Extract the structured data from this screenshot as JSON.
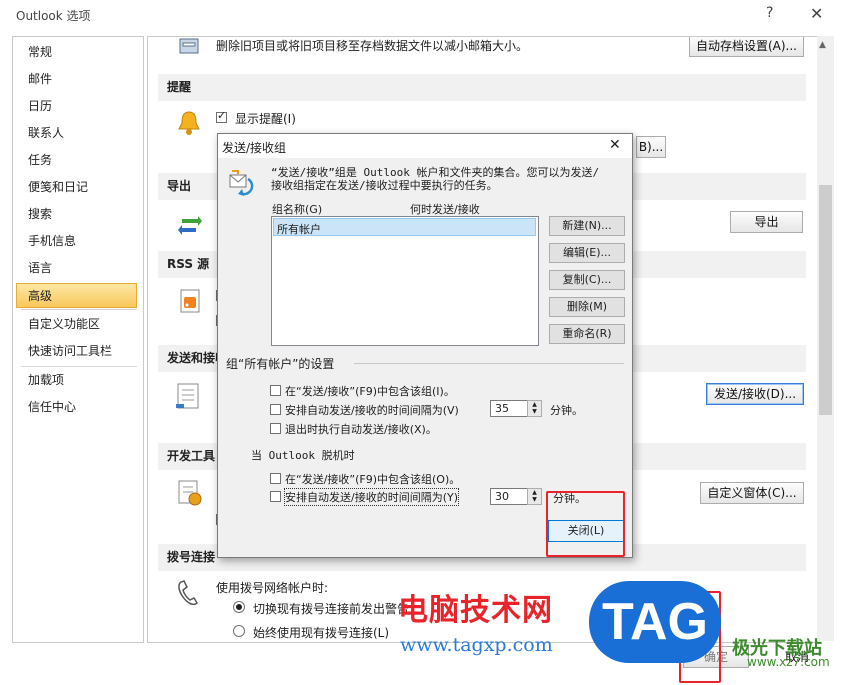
{
  "window": {
    "title": "Outlook 选项",
    "help_glyph": "?",
    "close_glyph": "✕"
  },
  "sidebar": {
    "items": [
      {
        "label": "常规"
      },
      {
        "label": "邮件"
      },
      {
        "label": "日历"
      },
      {
        "label": "联系人"
      },
      {
        "label": "任务"
      },
      {
        "label": "便笺和日记"
      },
      {
        "label": "搜索"
      },
      {
        "label": "手机信息"
      },
      {
        "label": "语言"
      },
      {
        "label": "高级"
      },
      {
        "label": "自定义功能区"
      },
      {
        "label": "快速访问工具栏"
      },
      {
        "label": "加载项"
      },
      {
        "label": "信任中心"
      }
    ],
    "active": "高级"
  },
  "content": {
    "autoarchive_text": "删除旧项目或将旧项目移至存档数据文件以减小邮箱大小。",
    "autoarchive_button": "自动存档设置(A)...",
    "reminders_header": "提醒",
    "show_reminders_label": "显示提醒(I)",
    "show_reminders_checked": true,
    "reminder_button_partial": "B)...",
    "export_header": "导出",
    "export_button": "导出",
    "rss_header": "RSS 源",
    "sendreceive_header": "发送和接收",
    "sendreceive_button": "发送/接收(D)...",
    "developer_header": "开发工具",
    "custom_forms_button": "自定义窗体(C)...",
    "dialup_header": "拨号连接",
    "dialup_text": "使用拨号网络帐户时:",
    "dialup_option1": "切换现有拨号连接前发出警告",
    "dialup_option2": "始终使用现有拨号连接(L)",
    "cancel_button": "取消"
  },
  "dialog": {
    "title": "发送/接收组",
    "close_glyph": "✕",
    "description_line1": "“发送/接收”组是 Outlook 帐户和文件夹的集合。您可以为发送/",
    "description_line2": "接收组指定在发送/接收过程中要执行的任务。",
    "col_group_name": "组名称(G)",
    "col_when": "何时发送/接收",
    "groups": [
      "所有帐户"
    ],
    "new_button": "新建(N)...",
    "edit_button": "编辑(E)...",
    "copy_button": "复制(C)...",
    "delete_button": "删除(M)",
    "rename_button": "重命名(R)",
    "settings_header": "组“所有帐户”的设置",
    "online_include_label": "在“发送/接收”(F9)中包含该组(I)。",
    "online_include_checked": false,
    "online_schedule_label": "安排自动发送/接收的时间间隔为(V)",
    "online_schedule_checked": false,
    "online_minutes": "35",
    "online_minutes_unit": "分钟。",
    "exit_label": "退出时执行自动发送/接收(X)。",
    "exit_checked": false,
    "offline_header": "当 Outlook 脱机时",
    "offline_include_label": "在“发送/接收”(F9)中包含该组(O)。",
    "offline_include_checked": false,
    "offline_schedule_label": "安排自动发送/接收的时间间隔为(Y)",
    "offline_schedule_checked": false,
    "offline_minutes": "30",
    "offline_minutes_unit": "分钟。",
    "close_button": "关闭(L)"
  },
  "watermark": {
    "site_cn": "电脑技术网",
    "site_url": "www.tagxp.com",
    "tag": "TAG",
    "brand": "极光下载站",
    "brand_url": "www.xz7.com",
    "partial_button": "确定"
  },
  "colors": {
    "highlight": "#e8242a",
    "active_nav": "#f8c85b",
    "selection": "#cce4f7"
  }
}
